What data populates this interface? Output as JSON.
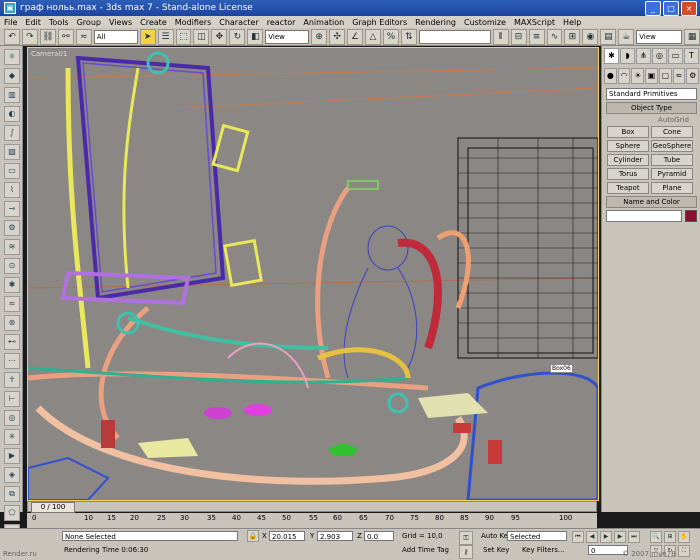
{
  "window": {
    "title": "граф нольь.max - 3ds max 7 - Stand-alone License"
  },
  "menu": [
    "File",
    "Edit",
    "Tools",
    "Group",
    "Views",
    "Create",
    "Modifiers",
    "Character",
    "reactor",
    "Animation",
    "Graph Editors",
    "Rendering",
    "Customize",
    "MAXScript",
    "Help"
  ],
  "toolbar": {
    "selection_filter": "All",
    "coord_system": "View",
    "view_right": "View"
  },
  "viewport": {
    "label": "Camera01",
    "object_tag": "Box06"
  },
  "command_panel": {
    "category": "Standard Primitives",
    "object_type": "Object Type",
    "autogrid": "AutoGrid",
    "primitives": [
      "Box",
      "Cone",
      "Sphere",
      "GeoSphere",
      "Cylinder",
      "Tube",
      "Torus",
      "Pyramid",
      "Teapot",
      "Plane"
    ],
    "name_and_color": "Name and Color"
  },
  "timeline": {
    "position": "0 / 100",
    "ticks": [
      "0",
      "10",
      "15",
      "20",
      "25",
      "30",
      "35",
      "40",
      "45",
      "50",
      "55",
      "60",
      "65",
      "70",
      "75",
      "80",
      "85",
      "90",
      "95",
      "100"
    ]
  },
  "status": {
    "selection": "None Selected",
    "render_time": "Rendering Time 0:06:30",
    "x_label": "X",
    "x": "20.015",
    "y_label": "Y",
    "y": "2.903",
    "z_label": "Z",
    "z": "0.0",
    "grid": "Grid = 10,0",
    "add_time_tag": "Add Time Tag",
    "auto_key": "Auto Key",
    "set_key": "Set Key",
    "key_mode": "Selected",
    "key_filters": "Key Filters...",
    "frame": "0",
    "watermark_left": "Render.ru",
    "watermark_right": "© 2007 mvn78"
  }
}
